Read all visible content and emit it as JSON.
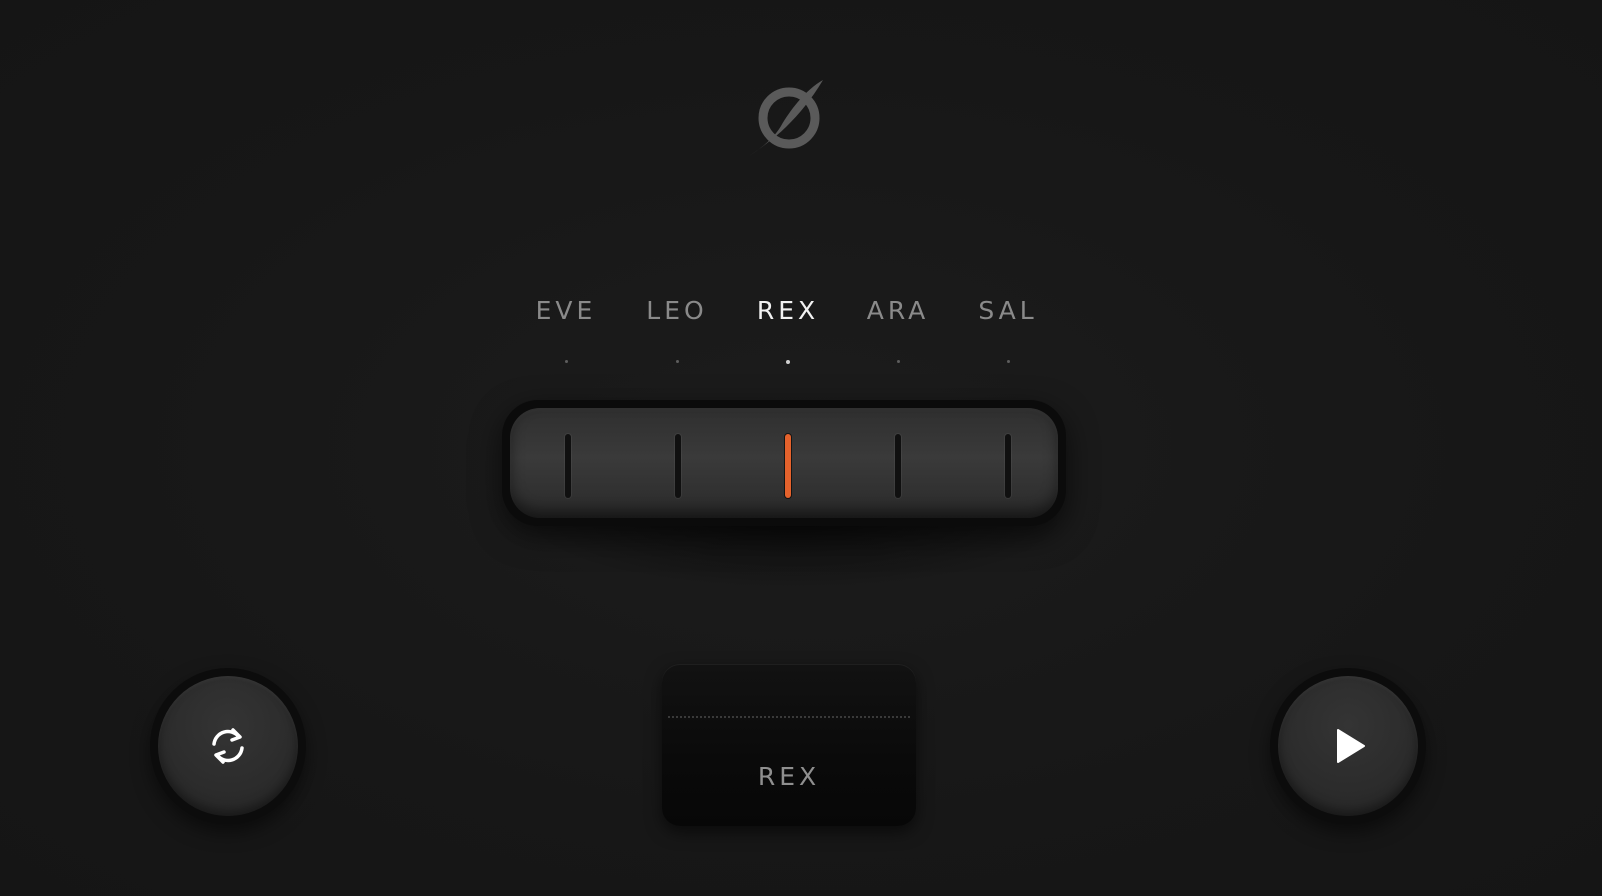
{
  "app": {
    "logo_icon": "leaf-circle-logo"
  },
  "voices": {
    "items": [
      {
        "label": "EVE",
        "active": false
      },
      {
        "label": "LEO",
        "active": false
      },
      {
        "label": "REX",
        "active": true
      },
      {
        "label": "ARA",
        "active": false
      },
      {
        "label": "SAL",
        "active": false
      }
    ],
    "selected_index": 2
  },
  "display": {
    "text": "REX"
  },
  "controls": {
    "left_button_icon": "refresh-icon",
    "right_button_icon": "play-icon"
  },
  "colors": {
    "background": "#171717",
    "accent": "#e5622c",
    "active_label": "#f2f2f2",
    "inactive_label": "#8a8a8a"
  }
}
